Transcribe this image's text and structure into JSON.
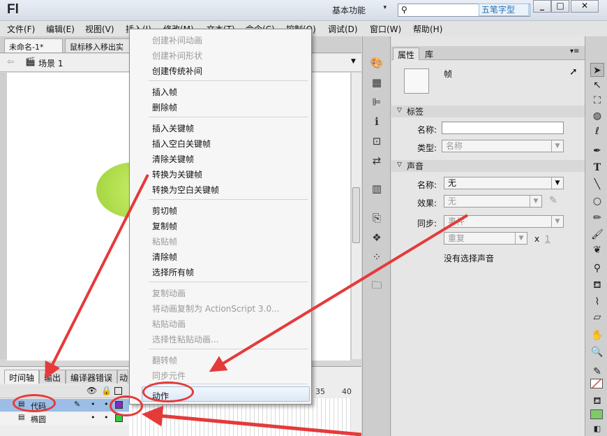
{
  "titlebar": {
    "logo": "Fl",
    "workspace": "基本功能",
    "watermark": "五笔字型",
    "min": "_",
    "max": "□",
    "close": "✕"
  },
  "menubar": [
    "文件(F)",
    "编辑(E)",
    "视图(V)",
    "插入(I)",
    "修改(M)",
    "文本(T)",
    "命令(C)",
    "控制(O)",
    "调试(D)",
    "窗口(W)",
    "帮助(H)"
  ],
  "doctabs": [
    "未命名-1*",
    "鼠标移入移出实"
  ],
  "scene": {
    "label": "场景 1"
  },
  "timeline": {
    "tabs": [
      "时间轴",
      "输出",
      "编译器错误",
      "动"
    ],
    "layers": [
      {
        "name": "代码",
        "color": "#7b2fbf"
      },
      {
        "name": "椭圆",
        "color": "#2fcc3a"
      }
    ],
    "frame_numbers": [
      "35",
      "40"
    ]
  },
  "context_menu": {
    "items": [
      {
        "label": "创建补间动画",
        "enabled": false
      },
      {
        "label": "创建补间形状",
        "enabled": false
      },
      {
        "label": "创建传统补间",
        "enabled": true
      },
      {
        "label": "插入帧",
        "enabled": true
      },
      {
        "label": "删除帧",
        "enabled": true
      },
      {
        "label": "插入关键帧",
        "enabled": true
      },
      {
        "label": "插入空白关键帧",
        "enabled": true
      },
      {
        "label": "清除关键帧",
        "enabled": true
      },
      {
        "label": "转换为关键帧",
        "enabled": true
      },
      {
        "label": "转换为空白关键帧",
        "enabled": true
      },
      {
        "label": "剪切帧",
        "enabled": true
      },
      {
        "label": "复制帧",
        "enabled": true
      },
      {
        "label": "粘贴帧",
        "enabled": false
      },
      {
        "label": "清除帧",
        "enabled": true
      },
      {
        "label": "选择所有帧",
        "enabled": true
      },
      {
        "label": "复制动画",
        "enabled": false
      },
      {
        "label": "将动画复制为 ActionScript 3.0...",
        "enabled": false
      },
      {
        "label": "粘贴动画",
        "enabled": false
      },
      {
        "label": "选择性粘贴动画...",
        "enabled": false
      },
      {
        "label": "翻转帧",
        "enabled": false
      },
      {
        "label": "同步元件",
        "enabled": false
      },
      {
        "label": "动作",
        "enabled": true
      }
    ]
  },
  "properties": {
    "tabs": [
      "属性",
      "库"
    ],
    "type_label": "帧",
    "sections": {
      "label": "标签",
      "sound": "声音"
    },
    "name_label": "名称:",
    "name_value": "",
    "type_field_label": "类型:",
    "type_value": "名称",
    "sound_name_label": "名称:",
    "sound_name_value": "无",
    "effect_label": "效果:",
    "effect_value": "无",
    "sync_label": "同步:",
    "sync_value": "事件",
    "repeat_value": "重复",
    "repeat_x": "x",
    "repeat_count": "1",
    "no_sound": "没有选择声音"
  },
  "colors": {
    "annotation": "#e53a3a",
    "layer_selected": "#9bbde6"
  }
}
